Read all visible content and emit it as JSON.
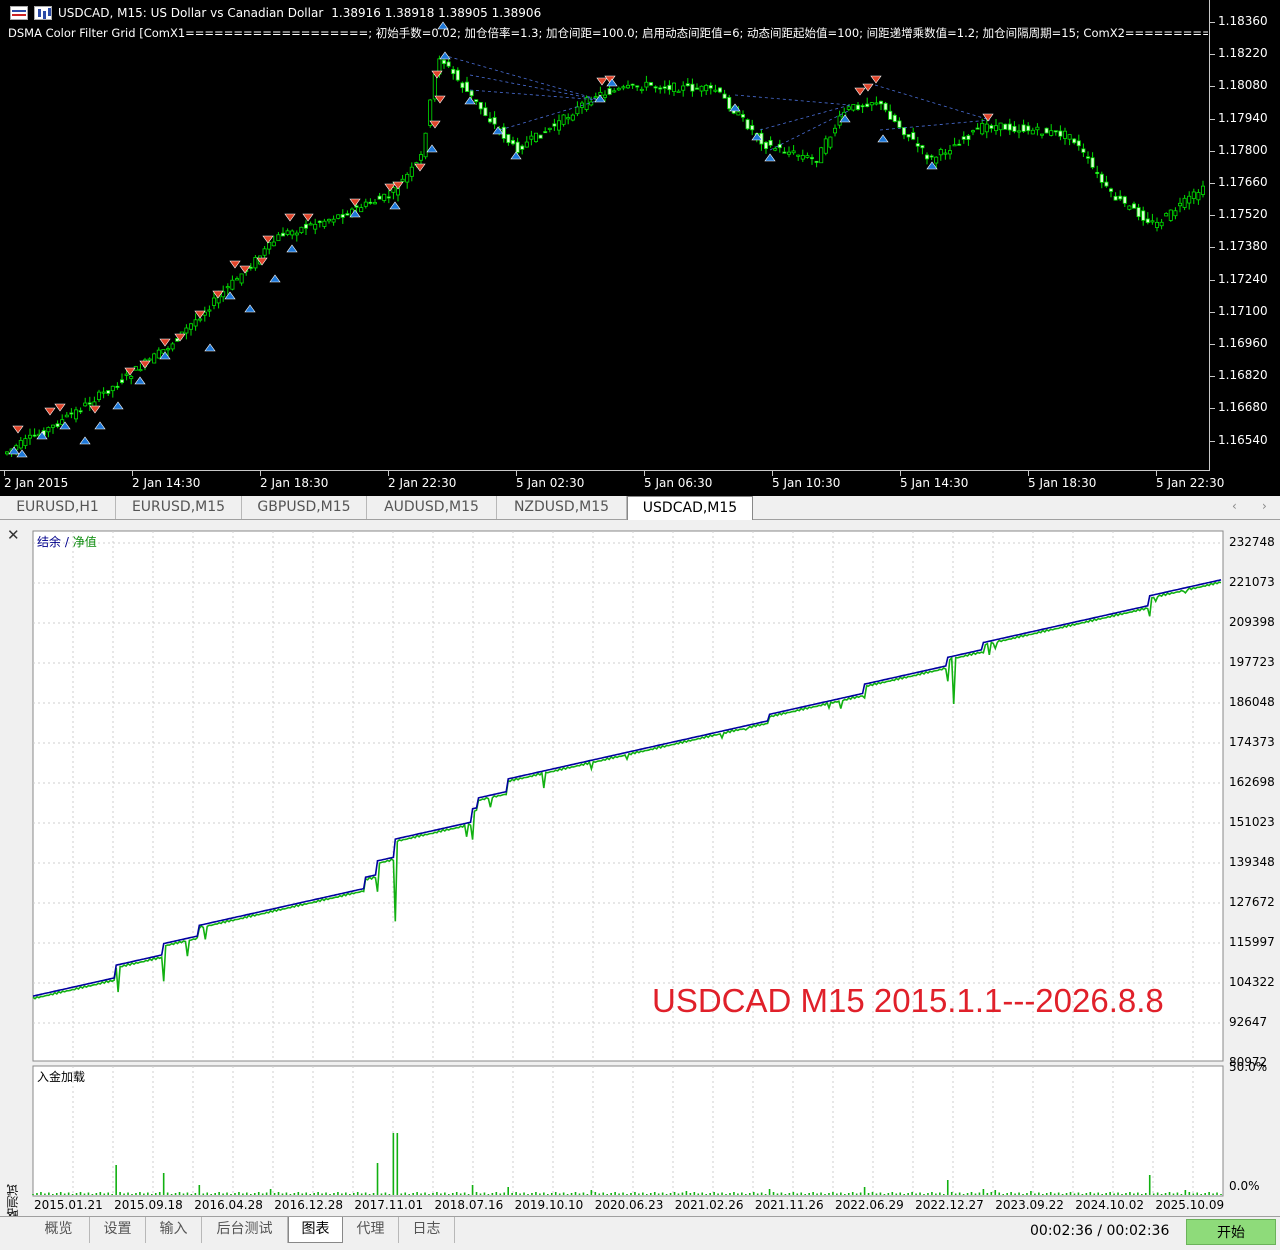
{
  "price_chart": {
    "symbol_info": "USDCAD, M15:  US Dollar vs Canadian Dollar",
    "ohlc": "1.38916 1.38918 1.38905 1.38906",
    "indicator_line": "DSMA Color Filter Grid [ComX1===================; 初始手数=0.02; 加仓倍率=1.3; 加仓间距=100.0; 启用动态间距值=6; 动态间距起始值=100; 间距递增乘数值=1.2; 加仓间隔周期=15; ComX2=========",
    "price_labels": [
      "1.18360",
      "1.18220",
      "1.18080",
      "1.17940",
      "1.17800",
      "1.17660",
      "1.17520",
      "1.17380",
      "1.17240",
      "1.17100",
      "1.16960",
      "1.16820",
      "1.16680",
      "1.16540"
    ],
    "time_labels": [
      "2 Jan 2015",
      "2 Jan 14:30",
      "2 Jan 18:30",
      "2 Jan 22:30",
      "5 Jan 02:30",
      "5 Jan 06:30",
      "5 Jan 10:30",
      "5 Jan 14:30",
      "5 Jan 18:30",
      "5 Jan 22:30"
    ],
    "colors": {
      "bull": "#00ff00",
      "bear": "#00ff00",
      "buy_arrow": "#1e78d8",
      "sell_arrow": "#e0442a",
      "link": "#4a6fd8"
    }
  },
  "symbol_tabs": [
    {
      "label": "EURUSD,H1",
      "active": false
    },
    {
      "label": "EURUSD,M15",
      "active": false
    },
    {
      "label": "GBPUSD,M15",
      "active": false
    },
    {
      "label": "AUDUSD,M15",
      "active": false
    },
    {
      "label": "NZDUSD,M15",
      "active": false
    },
    {
      "label": "USDCAD,M15",
      "active": true
    }
  ],
  "tester": {
    "close_icon": "close-icon",
    "side_title": "策略测试",
    "legend": {
      "balance": "结余",
      "sep": " / ",
      "equity": "净值"
    },
    "caption": "USDCAD M15 2015.1.1---2026.8.8",
    "deposit_title": "入金加载",
    "y_labels": [
      "232748",
      "221073",
      "209398",
      "197723",
      "186048",
      "174373",
      "162698",
      "151023",
      "139348",
      "127672",
      "115997",
      "104322",
      "92647",
      "80972"
    ],
    "deposit_labels": [
      "50.0%",
      "0.0%"
    ],
    "date_labels": [
      "2015.01.21",
      "2015.09.18",
      "2016.04.28",
      "2016.12.28",
      "2017.11.01",
      "2018.07.16",
      "2019.10.10",
      "2020.06.23",
      "2021.02.26",
      "2021.11.26",
      "2022.06.29",
      "2022.12.27",
      "2023.09.22",
      "2024.10.02",
      "2025.10.09"
    ],
    "colors": {
      "balance": "#0000a0",
      "equity": "#11b011",
      "grid": "#cfcfcf"
    }
  },
  "bottom_tabs": [
    {
      "label": "概览",
      "active": false
    },
    {
      "label": "设置",
      "active": false
    },
    {
      "label": "输入",
      "active": false
    },
    {
      "label": "后台测试",
      "active": false
    },
    {
      "label": "图表",
      "active": true
    },
    {
      "label": "代理",
      "active": false
    },
    {
      "label": "日志",
      "active": false
    }
  ],
  "status": {
    "timer": "00:02:36 / 00:02:36",
    "start_label": "开始"
  }
}
